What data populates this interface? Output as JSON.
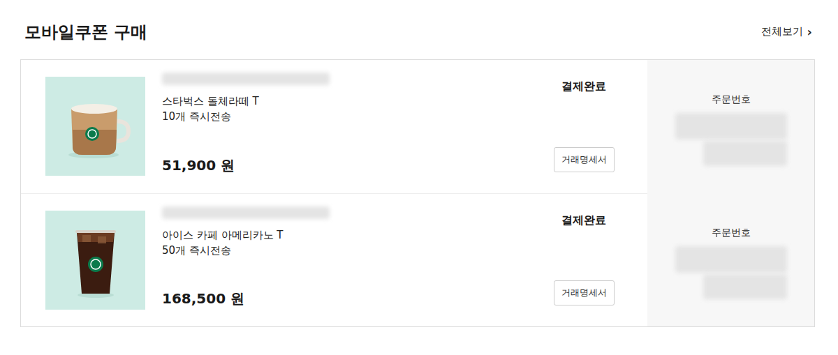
{
  "section": {
    "title": "모바일쿠폰 구매",
    "view_all": "전체보기",
    "view_all_chevron": "›"
  },
  "orders": [
    {
      "kind": "hot-latte",
      "name": "스타벅스 돌체라떼 T",
      "quantity": "10개 즉시전송",
      "price": "51,900 원",
      "status": "결제완료",
      "receipt_button": "거래명세서",
      "order_label": "주문번호"
    },
    {
      "kind": "iced-coffee",
      "name": "아이스 카페 아메리카노 T",
      "quantity": "50개 즉시전송",
      "price": "168,500 원",
      "status": "결제완료",
      "receipt_button": "거래명세서",
      "order_label": "주문번호"
    }
  ]
}
